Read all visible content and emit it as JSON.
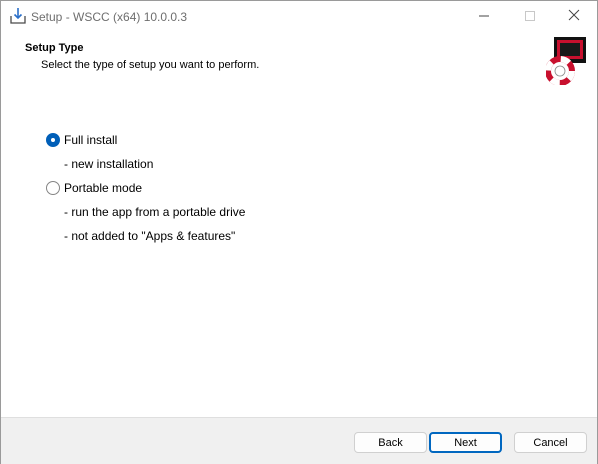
{
  "window": {
    "title": "Setup - WSCC (x64) 10.0.0.3",
    "icon": "installer-icon",
    "controls": {
      "minimize": "minimize-icon",
      "maximize": "maximize-icon",
      "close": "close-icon"
    }
  },
  "header": {
    "title": "Setup Type",
    "subtitle": "Select the type of setup you want to perform.",
    "logo": "wscc-lifebuoy-logo"
  },
  "options": [
    {
      "label": "Full install",
      "selected": true,
      "details": [
        "- new installation"
      ]
    },
    {
      "label": "Portable mode",
      "selected": false,
      "details": [
        "- run the app from a portable drive",
        "- not added to \"Apps & features\""
      ]
    }
  ],
  "footer": {
    "back_label": "Back",
    "next_label": "Next",
    "cancel_label": "Cancel"
  },
  "colors": {
    "accent": "#005fb8",
    "footer_bg": "#f0f0f0"
  }
}
